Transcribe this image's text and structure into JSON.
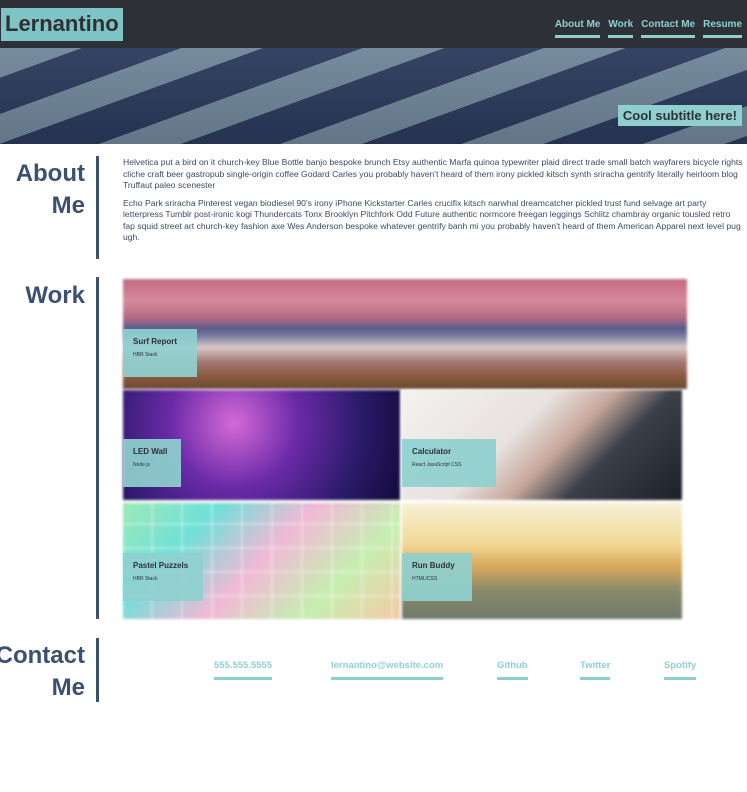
{
  "header": {
    "logo": "Lernantino",
    "nav": [
      "About Me",
      "Work",
      "Contact Me",
      "Resume"
    ]
  },
  "hero": {
    "subtitle": "Cool subtitle here!"
  },
  "about": {
    "title_line1": "About",
    "title_line2": "Me",
    "paragraphs": [
      "Helvetica put a bird on it church-key Blue Bottle banjo bespoke brunch Etsy authentic Marfa quinoa typewriter plaid direct trade small batch wayfarers bicycle rights cliche craft beer gastropub single-origin coffee Godard Carles you probably haven't heard of them irony pickled kitsch synth sriracha gentrify literally heirloom blog Truffaut paleo scenester",
      "Echo Park sriracha Pinterest vegan biodiesel 90's irony iPhone Kickstarter Carles crucifix kitsch narwhal dreamcatcher pickled trust fund selvage art party letterpress Tumblr post-ironic kogi Thundercats Tonx Brooklyn Pitchfork Odd Future authentic normcore freegan leggings Schlitz chambray organic tousled retro fap squid street art church-key fashion axe Wes Anderson bespoke whatever gentrify banh mi you probably haven't heard of them American Apparel next level pug ugh."
    ]
  },
  "work": {
    "title": "Work",
    "projects": [
      {
        "title": "Surf Report",
        "subtitle": "HBR Stack"
      },
      {
        "title": "LED Wall",
        "subtitle": "Node.js"
      },
      {
        "title": "Calculator",
        "subtitle": "React JavaScript CSS"
      },
      {
        "title": "Pastel Puzzels",
        "subtitle": "HBR Stack"
      },
      {
        "title": "Run Buddy",
        "subtitle": "HTML/CSS"
      }
    ]
  },
  "contact": {
    "title_line1": "Contact",
    "title_line2": "Me",
    "links": [
      "555.555.5555",
      "lernantino@website.com",
      "Github",
      "Twitter",
      "Spotify"
    ]
  },
  "colors": {
    "header_bg": "#2e3038",
    "accent": "#8fd0cf",
    "heading": "#3c5070"
  }
}
